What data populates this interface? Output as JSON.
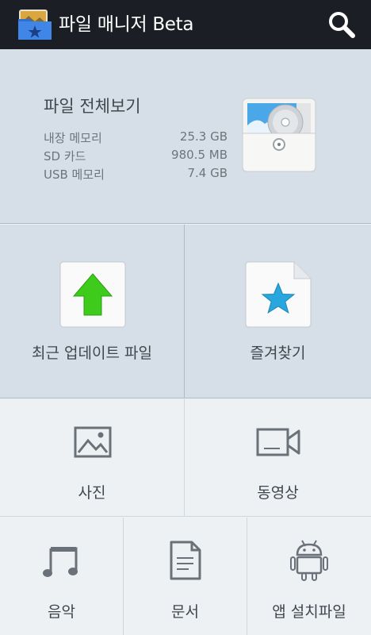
{
  "appbar": {
    "title": "파일 매니저 Beta",
    "icon": "app-folder-star-icon",
    "search_icon": "search-icon"
  },
  "summary": {
    "title": "파일 전체보기",
    "icon": "disc-folder-icon",
    "storage": [
      {
        "label": "내장 메모리",
        "value": "25.3 GB"
      },
      {
        "label": "SD 카드",
        "value": "980.5 MB"
      },
      {
        "label": "USB 메모리",
        "value": "7.4 GB"
      }
    ]
  },
  "tiles": {
    "recent": {
      "label": "최근 업데이트 파일",
      "icon": "upload-arrow-icon"
    },
    "favorites": {
      "label": "즐겨찾기",
      "icon": "star-folder-icon"
    },
    "photo": {
      "label": "사진",
      "icon": "image-icon"
    },
    "video": {
      "label": "동영상",
      "icon": "video-camera-icon"
    },
    "music": {
      "label": "음악",
      "icon": "music-note-icon"
    },
    "documents": {
      "label": "문서",
      "icon": "document-icon"
    },
    "apps": {
      "label": "앱 설치파일",
      "icon": "android-icon"
    }
  },
  "colors": {
    "appbar_bg": "#1b1f25",
    "panel_blue": "#d6dfe7",
    "panel_light": "#eef1f4",
    "arrow_green": "#3ecb1c",
    "star_blue": "#2aa6de",
    "icon_gray": "#6b7178"
  }
}
